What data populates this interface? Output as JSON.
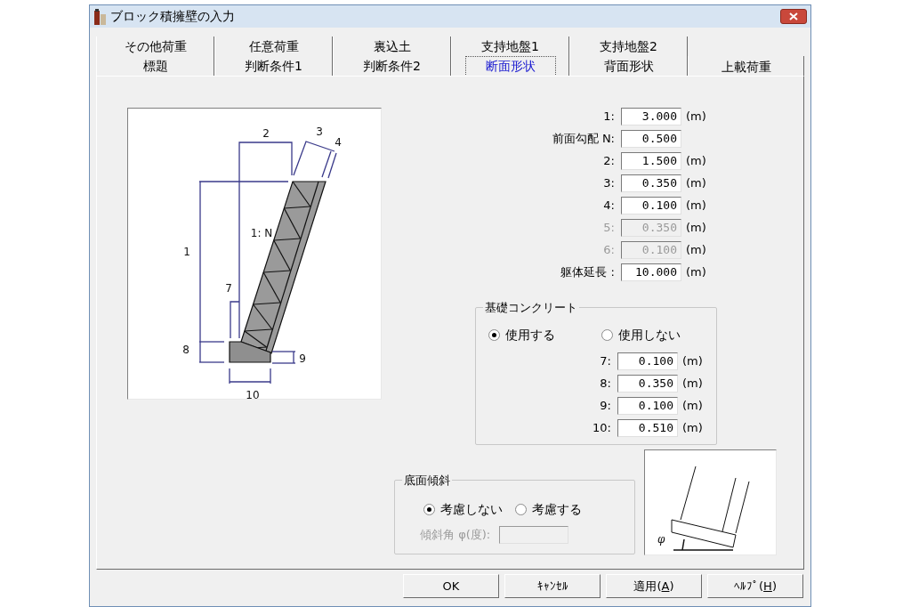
{
  "window": {
    "title": "ブロック積擁壁の入力"
  },
  "tab_rows": [
    [
      {
        "label": "その他荷重",
        "selected": false
      },
      {
        "label": "任意荷重",
        "selected": false
      },
      {
        "label": "裏込土",
        "selected": false
      },
      {
        "label": "支持地盤1",
        "selected": false
      },
      {
        "label": "支持地盤2",
        "selected": false
      }
    ],
    [
      {
        "label": "標題",
        "selected": false
      },
      {
        "label": "判断条件1",
        "selected": false
      },
      {
        "label": "判断条件2",
        "selected": false
      },
      {
        "label": "断面形状",
        "selected": true
      },
      {
        "label": "背面形状",
        "selected": false
      },
      {
        "label": "上載荷重",
        "selected": false
      }
    ]
  ],
  "diagram": {
    "labels": [
      "2",
      "3",
      "4",
      "1",
      "1: N",
      "7",
      "8",
      "9",
      "10"
    ]
  },
  "fields": [
    {
      "label": "1:",
      "value": "3.000",
      "unit": "(m)",
      "disabled": false
    },
    {
      "label": "前面勾配 N:",
      "value": "0.500",
      "disabled": false
    },
    {
      "label": "2:",
      "value": "1.500",
      "unit": "(m)",
      "disabled": false
    },
    {
      "label": "3:",
      "value": "0.350",
      "unit": "(m)",
      "disabled": false
    },
    {
      "label": "4:",
      "value": "0.100",
      "unit": "(m)",
      "disabled": false
    },
    {
      "label": "5:",
      "value": "0.350",
      "unit": "(m)",
      "disabled": true
    },
    {
      "label": "6:",
      "value": "0.100",
      "unit": "(m)",
      "disabled": true
    },
    {
      "label": "躯体延長 :",
      "value": "10.000",
      "unit": "(m)",
      "disabled": false
    }
  ],
  "foundation": {
    "title": "基礎コンクリート",
    "options": [
      {
        "label": "使用する",
        "selected": true
      },
      {
        "label": "使用しない",
        "selected": false
      }
    ],
    "fields": [
      {
        "label": "7:",
        "value": "0.100",
        "unit": "(m)",
        "disabled": false
      },
      {
        "label": "8:",
        "value": "0.350",
        "unit": "(m)",
        "disabled": false
      },
      {
        "label": "9:",
        "value": "0.100",
        "unit": "(m)",
        "disabled": false
      },
      {
        "label": "10:",
        "value": "0.510",
        "unit": "(m)",
        "disabled": false
      }
    ]
  },
  "bottom_slope": {
    "title": "底面傾斜",
    "options": [
      {
        "label": "考慮しない",
        "selected": true
      },
      {
        "label": "考慮する",
        "selected": false
      }
    ],
    "angle_label": "傾斜角 φ(度):",
    "angle_disabled": true
  },
  "slope_picture": {
    "label": "φ"
  },
  "buttons": [
    {
      "text": "OK"
    },
    {
      "text": "ｷｬﾝｾﾙ"
    },
    {
      "text": "適用(",
      "accel": "A",
      "after": ")"
    },
    {
      "text": "ﾍﾙﾌﾟ(",
      "accel": "H",
      "after": ")"
    }
  ]
}
